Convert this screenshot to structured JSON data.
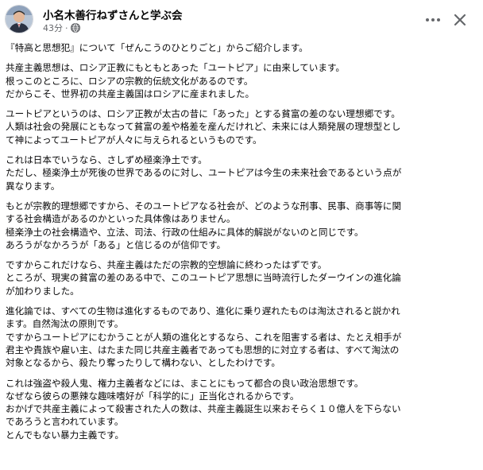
{
  "post": {
    "author": "小名木善行ねずさんと学ぶ会",
    "timestamp": "43分",
    "separator": "·",
    "icons": {
      "privacy": "globe-icon",
      "more": "more-options-icon",
      "close": "close-icon"
    },
    "paragraphs": [
      {
        "lines": [
          "『特高と思想犯』について「ぜんこうのひとりごと」からご紹介します。"
        ]
      },
      {
        "lines": [
          "共産主義思想は、ロシア正教にもともとあった「ユートピア」に由来しています。",
          "根っこのところに、ロシアの宗教的伝統文化があるのです。",
          "だからこそ、世界初の共産主義国はロシアに産まれました。"
        ]
      },
      {
        "lines": [
          "ユートピアというのは、ロシア正教が太古の昔に「あった」とする貧富の差のない理想郷です。",
          "人類は社会の発展にともなって貧富の差や格差を産んだけれど、未来には人類発展の理想型とし",
          "て神によってユートピアが人々に与えられるというものです。"
        ]
      },
      {
        "lines": [
          "これは日本でいうなら、さしずめ極楽浄土です。",
          "ただし、極楽浄土が死後の世界であるのに対し、ユートピアは今生の未来社会であるという点が",
          "異なります。"
        ]
      },
      {
        "lines": [
          "もとが宗教的理想郷ですから、そのユートピアなる社会が、どのような刑事、民事、商事等に関",
          "する社会構造があるのかといった具体像はありません。",
          "極楽浄土の社会構造や、立法、司法、行政の仕組みに具体的解説がないのと同じです。",
          "あろうがなかろうが「ある」と信じるのが信仰です。"
        ]
      },
      {
        "lines": [
          "ですからこれだけなら、共産主義はただの宗教的空想論に終わったはずです。",
          "ところが、現実の貧富の差のある中で、このユートピア思想に当時流行したダーウインの進化論",
          "が加わりました。"
        ]
      },
      {
        "lines": [
          "進化論では、すべての生物は進化するものであり、進化に乗り遅れたものは淘汰されると説かれ",
          "ます。自然淘汰の原則です。",
          "ですからユートピアにむかうことが人類の進化とするなら、これを阻害する者は、たとえ相手が",
          "君主や貴族や雇い主、はたまた同じ共産主義者であっても思想的に対立する者は、すべて淘汰の",
          "対象となるから、殺たり奪ったりして構わない、としたわけです。"
        ]
      },
      {
        "lines": [
          "これは強盗や殺人鬼、権力主義者などには、まことにもって都合の良い政治思想です。",
          "なぜなら彼らの悪辣な趣味嗜好が「科学的に」正当化されるからです。",
          "おかげで共産主義によって殺害された人の数は、共産主義誕生以来おそらく１０億人を下らない",
          "であろうと言われています。",
          "とんでもない暴力主義です。"
        ]
      }
    ]
  }
}
